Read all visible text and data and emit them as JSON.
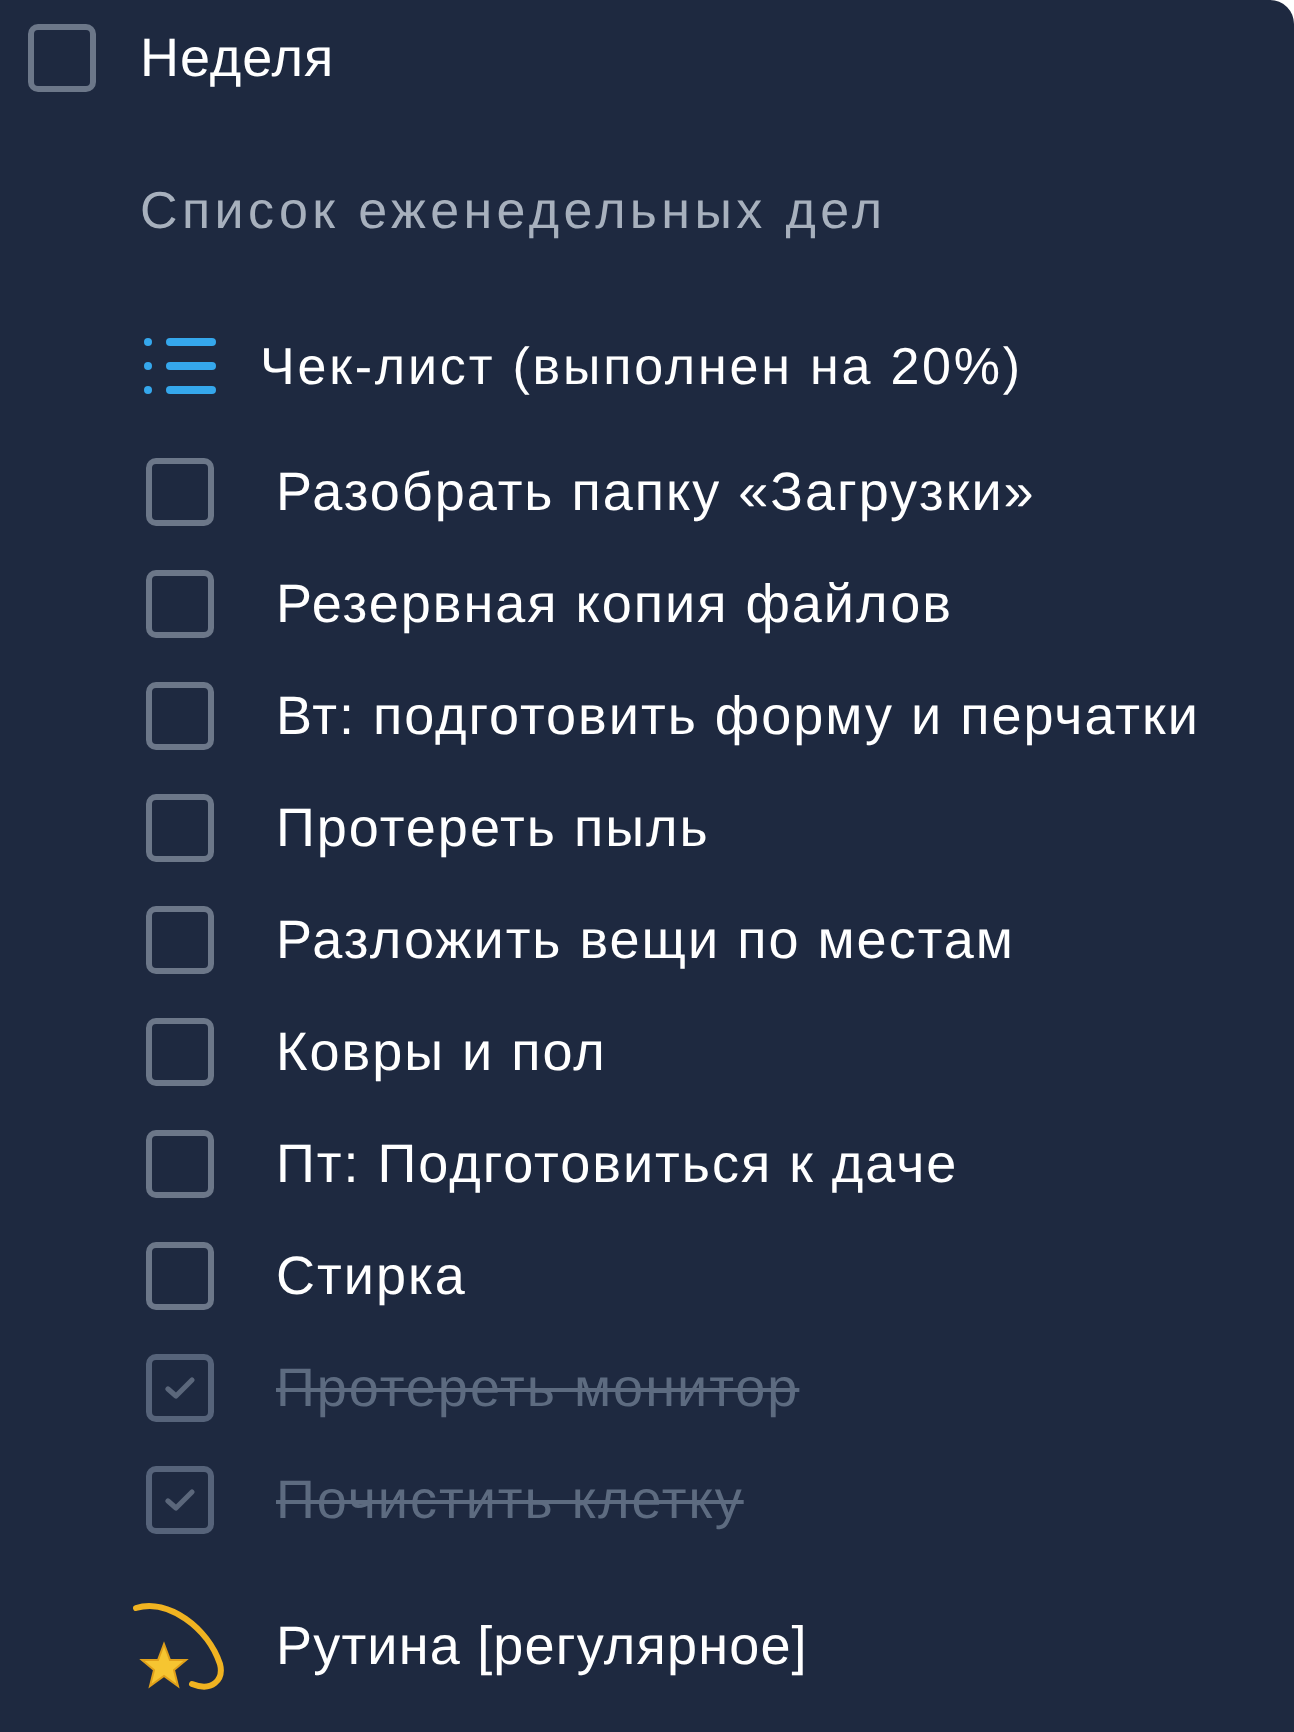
{
  "task": {
    "title": "Неделя",
    "checked": false
  },
  "description": "Список еженедельных дел",
  "checklist": {
    "title": "Чек-лист (выполнен на 20%)",
    "items": [
      {
        "text": "Разобрать папку «Загрузки»",
        "checked": false
      },
      {
        "text": "Резервная копия файлов",
        "checked": false
      },
      {
        "text": "Вт: подготовить форму и перчатки",
        "checked": false
      },
      {
        "text": "Протереть пыль",
        "checked": false
      },
      {
        "text": "Разложить вещи по местам",
        "checked": false
      },
      {
        "text": "Ковры и пол",
        "checked": false
      },
      {
        "text": "Пт: Подготовиться к даче",
        "checked": false
      },
      {
        "text": "Стирка",
        "checked": false
      },
      {
        "text": "Протереть монитор",
        "checked": true
      },
      {
        "text": "Почистить клетку",
        "checked": true
      }
    ]
  },
  "routine": {
    "label": "Рутина [регулярное]"
  }
}
